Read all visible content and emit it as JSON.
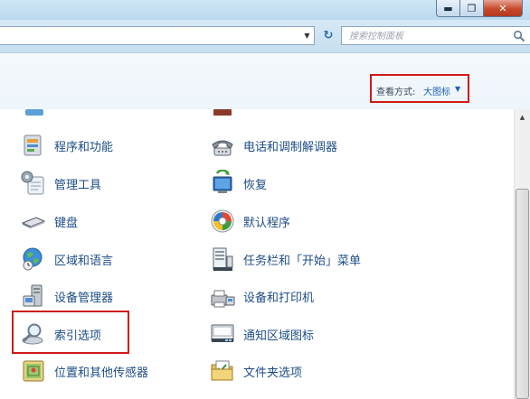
{
  "window": {
    "minimize_symbol": "▬",
    "maximize_symbol": "❐",
    "close_symbol": "✕"
  },
  "address_bar": {
    "dropdown_symbol": "▼",
    "refresh_symbol": "↻"
  },
  "search": {
    "placeholder": "搜索控制面板"
  },
  "view_options": {
    "label": "查看方式:",
    "value": "大图标",
    "arrow": "▼"
  },
  "items_left": [
    {
      "label": "程序和功能",
      "icon": "programs-features-icon"
    },
    {
      "label": "管理工具",
      "icon": "admin-tools-icon"
    },
    {
      "label": "键盘",
      "icon": "keyboard-icon"
    },
    {
      "label": "区域和语言",
      "icon": "region-language-icon"
    },
    {
      "label": "设备管理器",
      "icon": "device-manager-icon"
    },
    {
      "label": "索引选项",
      "icon": "indexing-options-icon"
    },
    {
      "label": "位置和其他传感器",
      "icon": "location-sensors-icon"
    }
  ],
  "items_right": [
    {
      "label": "电话和调制解调器",
      "icon": "phone-modem-icon"
    },
    {
      "label": "恢复",
      "icon": "recovery-icon"
    },
    {
      "label": "默认程序",
      "icon": "default-programs-icon"
    },
    {
      "label": "任务栏和「开始」菜单",
      "icon": "taskbar-start-icon"
    },
    {
      "label": "设备和打印机",
      "icon": "devices-printers-icon"
    },
    {
      "label": "通知区域图标",
      "icon": "notification-area-icon"
    },
    {
      "label": "文件夹选项",
      "icon": "folder-options-icon"
    }
  ],
  "colors": {
    "link_text": "#1e4d86",
    "highlight_border": "#d11a1a",
    "view_value": "#1e5fb3"
  }
}
